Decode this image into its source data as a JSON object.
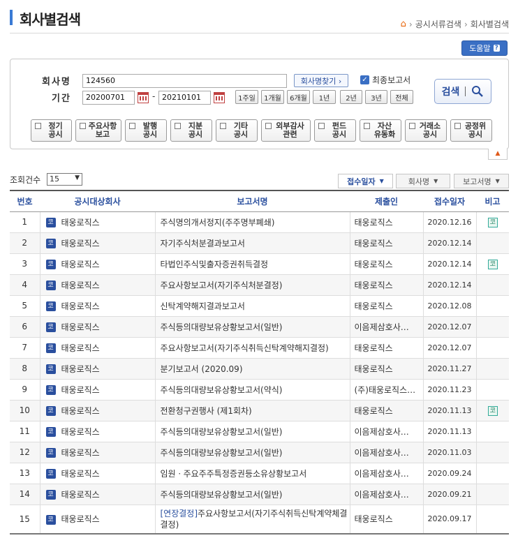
{
  "header": {
    "title": "회사별검색",
    "breadcrumb": [
      "공시서류검색",
      "회사별검색"
    ]
  },
  "help_label": "도움말",
  "search": {
    "company_label": "회사명",
    "company_value": "124560",
    "find_company_label": "회사명찾기 ›",
    "latest_report_label": "최종보고서",
    "latest_report_checked": true,
    "period_label": "기간",
    "date_from": "20200701",
    "date_to": "20210101",
    "period_buttons": [
      "1주일",
      "1개월",
      "6개월",
      "1년",
      "2년",
      "3년",
      "전체"
    ],
    "search_label": "검색",
    "categories": [
      "정기\n공시",
      "주요사항\n보고",
      "발행\n공시",
      "지분\n공시",
      "기타\n공시",
      "외부감사\n관련",
      "펀드\n공시",
      "자산\n유동화",
      "거래소\n공시",
      "공정위\n공시"
    ]
  },
  "results": {
    "count_label": "조회건수",
    "count_value": "15",
    "sort_buttons": [
      "접수일자",
      "회사명",
      "보고서명"
    ],
    "columns": [
      "번호",
      "공시대상회사",
      "보고서명",
      "제출인",
      "접수일자",
      "비고"
    ],
    "rows": [
      {
        "no": "1",
        "company": "태웅로직스",
        "report": "주식명의개서정지(주주명부폐쇄)",
        "submitter": "태웅로직스",
        "date": "2020.12.16",
        "note": "코"
      },
      {
        "no": "2",
        "company": "태웅로직스",
        "report": "자기주식처분결과보고서",
        "submitter": "태웅로직스",
        "date": "2020.12.14",
        "note": ""
      },
      {
        "no": "3",
        "company": "태웅로직스",
        "report": "타법인주식및출자증권취득결정",
        "submitter": "태웅로직스",
        "date": "2020.12.14",
        "note": "코"
      },
      {
        "no": "4",
        "company": "태웅로직스",
        "report": "주요사항보고서(자기주식처분결정)",
        "submitter": "태웅로직스",
        "date": "2020.12.14",
        "note": ""
      },
      {
        "no": "5",
        "company": "태웅로직스",
        "report": "신탁계약해지결과보고서",
        "submitter": "태웅로직스",
        "date": "2020.12.08",
        "note": ""
      },
      {
        "no": "6",
        "company": "태웅로직스",
        "report": "주식등의대량보유상황보고서(일반)",
        "submitter": "이음제삼호사…",
        "date": "2020.12.07",
        "note": ""
      },
      {
        "no": "7",
        "company": "태웅로직스",
        "report": "주요사항보고서(자기주식취득신탁계약해지결정)",
        "submitter": "태웅로직스",
        "date": "2020.12.07",
        "note": ""
      },
      {
        "no": "8",
        "company": "태웅로직스",
        "report": "분기보고서 (2020.09)",
        "submitter": "태웅로직스",
        "date": "2020.11.27",
        "note": ""
      },
      {
        "no": "9",
        "company": "태웅로직스",
        "report": "주식등의대량보유상황보고서(약식)",
        "submitter": "(주)태웅로직스…",
        "date": "2020.11.23",
        "note": ""
      },
      {
        "no": "10",
        "company": "태웅로직스",
        "report": "전환청구권행사 (제1회차)",
        "submitter": "태웅로직스",
        "date": "2020.11.13",
        "note": "코"
      },
      {
        "no": "11",
        "company": "태웅로직스",
        "report": "주식등의대량보유상황보고서(일반)",
        "submitter": "이음제삼호사…",
        "date": "2020.11.13",
        "note": ""
      },
      {
        "no": "12",
        "company": "태웅로직스",
        "report": "주식등의대량보유상황보고서(일반)",
        "submitter": "이음제삼호사…",
        "date": "2020.11.03",
        "note": ""
      },
      {
        "no": "13",
        "company": "태웅로직스",
        "report": "임원ㆍ주요주주특정증권등소유상황보고서",
        "submitter": "이음제삼호사…",
        "date": "2020.09.24",
        "note": ""
      },
      {
        "no": "14",
        "company": "태웅로직스",
        "report": "주식등의대량보유상황보고서(일반)",
        "submitter": "이음제삼호사…",
        "date": "2020.09.21",
        "note": ""
      },
      {
        "no": "15",
        "company": "태웅로직스",
        "report_tag": "[연장결정]",
        "report": "주요사항보고서(자기주식취득신탁계약체결결정)",
        "submitter": "태웅로직스",
        "date": "2020.09.17",
        "note": ""
      }
    ],
    "market_badge": "코"
  }
}
